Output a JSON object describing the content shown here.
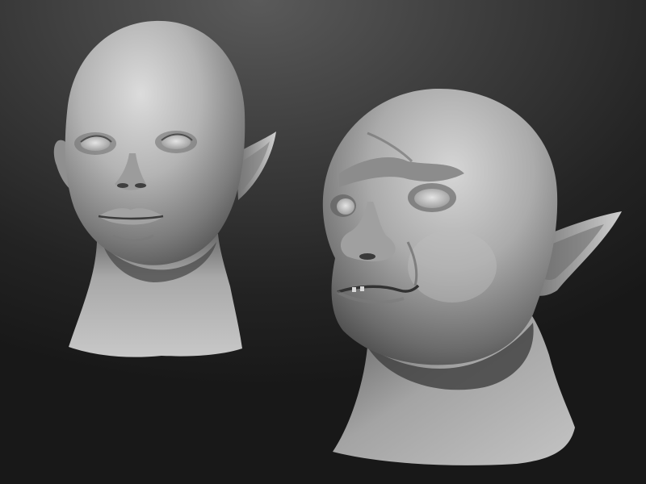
{
  "scene": {
    "background_top": "#5a5a5a",
    "background_bottom": "#181818",
    "clay_light": "#d8d8d8",
    "clay_mid": "#a9a9a9",
    "clay_shadow": "#5e5e5e",
    "clay_deep": "#3a3a3a"
  },
  "sculptures": [
    {
      "id": "elf-female-bust",
      "view": "front"
    },
    {
      "id": "goblin-male-bust",
      "view": "three-quarter"
    }
  ]
}
